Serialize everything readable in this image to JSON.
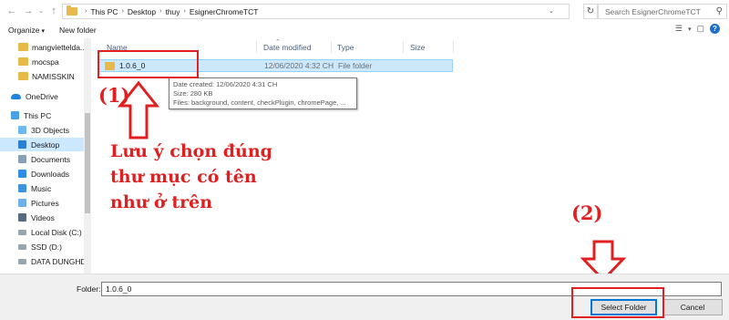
{
  "address_bar": {
    "crumbs": [
      "This PC",
      "Desktop",
      "thuy",
      "EsignerChromeTCT"
    ],
    "search_placeholder": "Search EsignerChromeTCT"
  },
  "toolbar": {
    "organize_label": "Organize",
    "new_folder_label": "New folder"
  },
  "nav": {
    "items": [
      {
        "label": "mangviettelda..."
      },
      {
        "label": "mocspa"
      },
      {
        "label": "NAMISSKIN"
      },
      {
        "label": "OneDrive"
      },
      {
        "label": "This PC"
      },
      {
        "label": "3D Objects"
      },
      {
        "label": "Desktop"
      },
      {
        "label": "Documents"
      },
      {
        "label": "Downloads"
      },
      {
        "label": "Music"
      },
      {
        "label": "Pictures"
      },
      {
        "label": "Videos"
      },
      {
        "label": "Local Disk (C:)"
      },
      {
        "label": "SSD (D:)"
      },
      {
        "label": "DATA DUNGHD"
      }
    ]
  },
  "columns": {
    "name": "Name",
    "date": "Date modified",
    "type": "Type",
    "size": "Size"
  },
  "files": [
    {
      "name": "1.0.6_0",
      "date": "12/06/2020 4:32 CH",
      "type": "File folder"
    }
  ],
  "tooltip": {
    "line1": "Date created: 12/06/2020 4:31 CH",
    "line2": "Size: 280 KB",
    "line3": "Files: background, content, checkPlugin, chromePage, ..."
  },
  "annotations": {
    "step1": "(1)",
    "step2": "(2)",
    "note_lines": [
      "Lưu ý chọn đúng",
      "thư mục có tên",
      "như ở trên"
    ],
    "color": "#e02020"
  },
  "footer": {
    "folder_label": "Folder:",
    "folder_value": "1.0.6_0",
    "select_button": "Select Folder",
    "cancel_button": "Cancel"
  }
}
